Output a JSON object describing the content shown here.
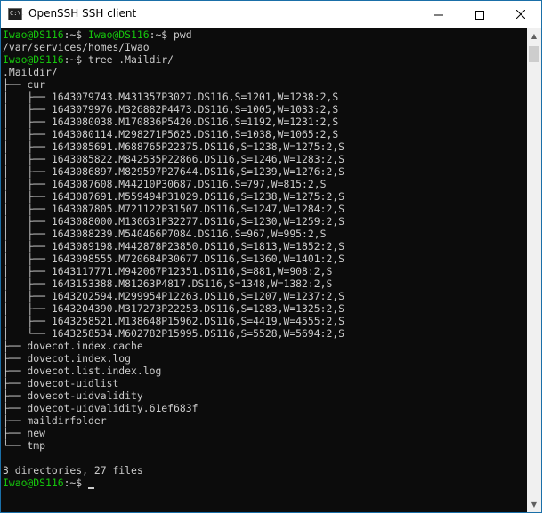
{
  "window": {
    "title": "OpenSSH SSH client",
    "icon_text": "C:\\.",
    "controls": {
      "minimize": "minimize-icon",
      "maximize": "maximize-icon",
      "close": "close-icon"
    }
  },
  "console": {
    "prompt": {
      "user_host": "Iwao@DS116",
      "sep": ":~$ "
    },
    "cmd1": "pwd",
    "pwd_output": "/var/services/homes/Iwao",
    "cmd2": "tree .Maildir/",
    "tree_root": ".Maildir/",
    "tree": [
      "├── cur",
      "│   ├── 1643079743.M431357P3027.DS116,S=1201,W=1238:2,S",
      "│   ├── 1643079976.M326882P4473.DS116,S=1005,W=1033:2,S",
      "│   ├── 1643080038.M170836P5420.DS116,S=1192,W=1231:2,S",
      "│   ├── 1643080114.M298271P5625.DS116,S=1038,W=1065:2,S",
      "│   ├── 1643085691.M688765P22375.DS116,S=1238,W=1275:2,S",
      "│   ├── 1643085822.M842535P22866.DS116,S=1246,W=1283:2,S",
      "│   ├── 1643086897.M829597P27644.DS116,S=1239,W=1276:2,S",
      "│   ├── 1643087608.M44210P30687.DS116,S=797,W=815:2,S",
      "│   ├── 1643087691.M559494P31029.DS116,S=1238,W=1275:2,S",
      "│   ├── 1643087805.M721122P31507.DS116,S=1247,W=1284:2,S",
      "│   ├── 1643088000.M130631P32277.DS116,S=1230,W=1259:2,S",
      "│   ├── 1643088239.M540466P7084.DS116,S=967,W=995:2,S",
      "│   ├── 1643089198.M442878P23850.DS116,S=1813,W=1852:2,S",
      "│   ├── 1643098555.M720684P30677.DS116,S=1360,W=1401:2,S",
      "│   ├── 1643117771.M942067P12351.DS116,S=881,W=908:2,S",
      "│   ├── 1643153388.M81263P4817.DS116,S=1348,W=1382:2,S",
      "│   ├── 1643202594.M299954P12263.DS116,S=1207,W=1237:2,S",
      "│   ├── 1643204390.M317273P22253.DS116,S=1283,W=1325:2,S",
      "│   ├── 1643258521.M138648P15962.DS116,S=4419,W=4555:2,S",
      "│   └── 1643258534.M602782P15995.DS116,S=5528,W=5694:2,S",
      "├── dovecot.index.cache",
      "├── dovecot.index.log",
      "├── dovecot.list.index.log",
      "├── dovecot-uidlist",
      "├── dovecot-uidvalidity",
      "├── dovecot-uidvalidity.61ef683f",
      "├── maildirfolder",
      "├── new",
      "└── tmp"
    ],
    "blank": "",
    "summary": "3 directories, 27 files"
  },
  "scrollbar": {
    "up": "scroll-up-arrow-icon",
    "down": "scroll-down-arrow-icon"
  }
}
